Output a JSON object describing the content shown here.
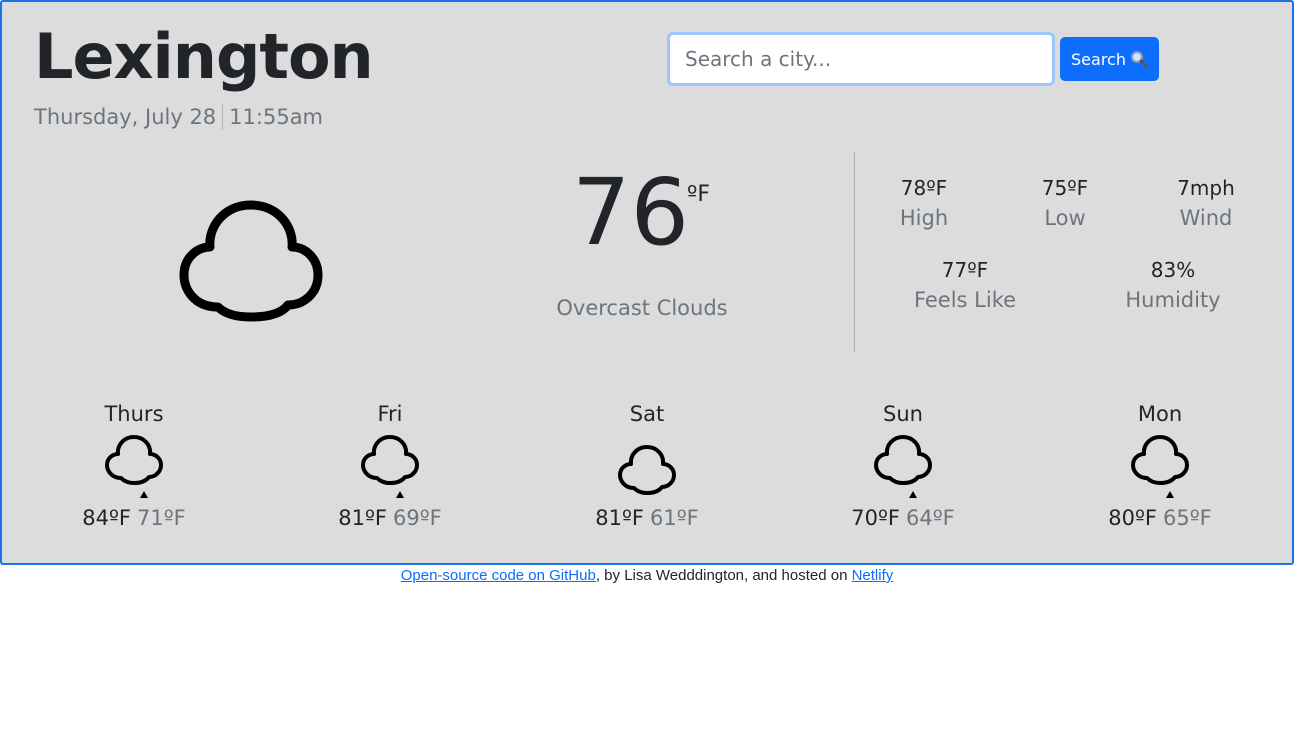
{
  "header": {
    "city": "Lexington",
    "date": "Thursday, July 28",
    "time": "11:55am"
  },
  "search": {
    "placeholder": "Search a city...",
    "value": "",
    "button_label": "Search"
  },
  "current": {
    "icon": "cloud-icon",
    "temperature": "76",
    "unit": "ºF",
    "description": "Overcast Clouds"
  },
  "stats": {
    "high": {
      "value": "78ºF",
      "label": "High"
    },
    "low": {
      "value": "75ºF",
      "label": "Low"
    },
    "wind": {
      "value": "7mph",
      "label": "Wind"
    },
    "feels_like": {
      "value": "77ºF",
      "label": "Feels Like"
    },
    "humidity": {
      "value": "83%",
      "label": "Humidity"
    }
  },
  "forecast": [
    {
      "day": "Thurs",
      "icon": "rain-cloud-icon",
      "high": "84ºF",
      "low": "71ºF"
    },
    {
      "day": "Fri",
      "icon": "rain-cloud-icon",
      "high": "81ºF",
      "low": "69ºF"
    },
    {
      "day": "Sat",
      "icon": "cloud-icon",
      "high": "81ºF",
      "low": "61ºF"
    },
    {
      "day": "Sun",
      "icon": "rain-cloud-icon",
      "high": "70ºF",
      "low": "64ºF"
    },
    {
      "day": "Mon",
      "icon": "rain-cloud-icon",
      "high": "80ºF",
      "low": "65ºF"
    }
  ],
  "footer": {
    "github_link": "Open-source code on GitHub",
    "middle": ", by Lisa Wedddington, and hosted on ",
    "netlify_link": "Netlify"
  },
  "colors": {
    "accent": "#0d6efd",
    "card_bg": "#dcdcdc",
    "muted": "#6c757d"
  }
}
